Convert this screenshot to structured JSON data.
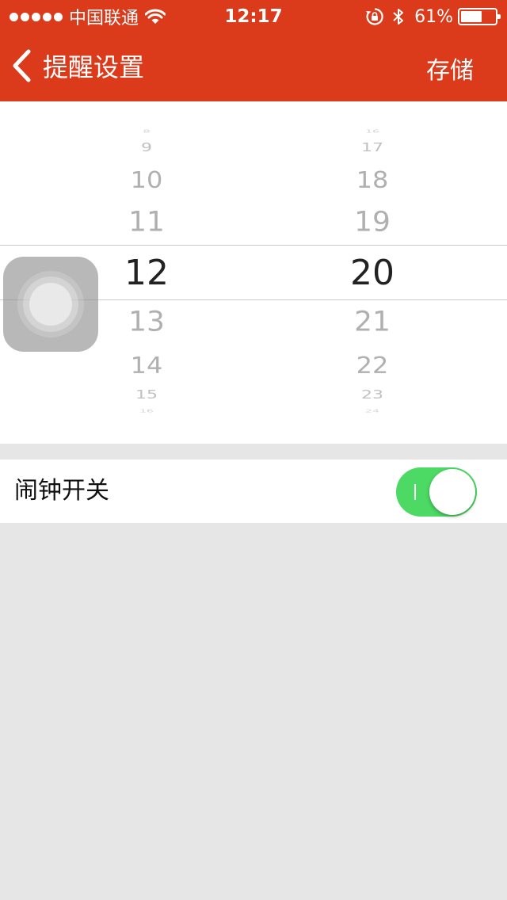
{
  "status_bar": {
    "carrier": "中国联通",
    "time": "12:17",
    "battery_text": "61%",
    "battery_level": 0.61,
    "icons": [
      "signal-dots-icon",
      "wifi-icon",
      "rotation-lock-icon",
      "bluetooth-icon",
      "battery-icon"
    ]
  },
  "nav": {
    "back_icon": "chevron-left-icon",
    "title": "提醒设置",
    "save_label": "存储"
  },
  "picker": {
    "hours": [
      "8",
      "9",
      "10",
      "11",
      "12",
      "13",
      "14",
      "15",
      "16"
    ],
    "minutes": [
      "16",
      "17",
      "18",
      "19",
      "20",
      "21",
      "22",
      "23",
      "24"
    ],
    "selected_hour": "12",
    "selected_minute": "20"
  },
  "alarm": {
    "label": "闹钟开关",
    "enabled": true
  },
  "colors": {
    "brand_red": "#db3a1b",
    "toggle_green": "#4cd964",
    "background": "#e6e6e6"
  }
}
